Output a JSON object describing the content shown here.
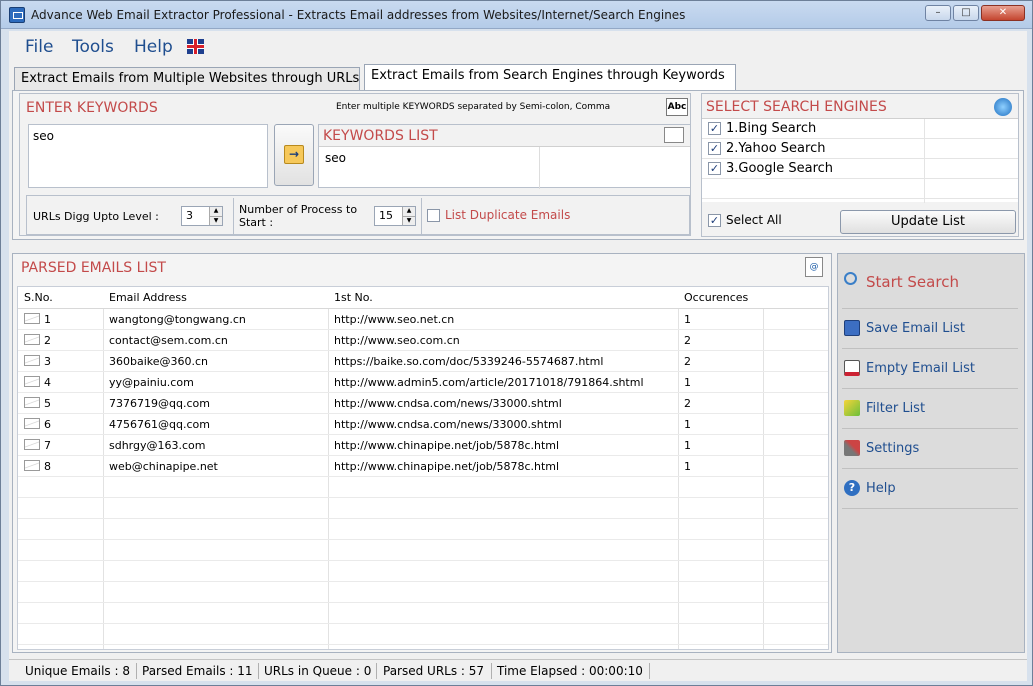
{
  "window": {
    "title": "Advance Web Email Extractor Professional - Extracts Email addresses from Websites/Internet/Search Engines",
    "min": "–",
    "max": "□",
    "close": "✕"
  },
  "menu": {
    "file": "File",
    "tools": "Tools",
    "help": "Help"
  },
  "tabs": [
    {
      "label": "Extract Emails from Multiple Websites through URLs"
    },
    {
      "label": "Extract Emails from Search Engines through Keywords"
    }
  ],
  "keywords": {
    "header": "ENTER KEYWORDS",
    "hint": "Enter multiple KEYWORDS separated by Semi-colon, Comma",
    "input_value": "seo",
    "list_header": "KEYWORDS LIST",
    "list_items": [
      "seo"
    ],
    "abc_icon": "Abc",
    "arrow_icon": "→"
  },
  "options": {
    "digg_label": "URLs Digg Upto Level :",
    "digg_value": "3",
    "process_label_1": "Number of Process to",
    "process_label_2": "Start :",
    "process_value": "15",
    "duplicate_label": "List Duplicate Emails"
  },
  "engines": {
    "header": "SELECT SEARCH ENGINES",
    "items": [
      {
        "label": "1.Bing Search",
        "checked": true
      },
      {
        "label": "2.Yahoo Search",
        "checked": true
      },
      {
        "label": "3.Google Search",
        "checked": true
      }
    ],
    "select_all": "Select All",
    "update_button": "Update List"
  },
  "emails": {
    "header": "PARSED EMAILS LIST",
    "columns": [
      "S.No.",
      "Email Address",
      "1st No.",
      "Occurences"
    ],
    "rows": [
      {
        "no": "1",
        "email": "wangtong@tongwang.cn",
        "url": "http://www.seo.net.cn",
        "occ": "1"
      },
      {
        "no": "2",
        "email": "contact@sem.com.cn",
        "url": "http://www.seo.com.cn",
        "occ": "2"
      },
      {
        "no": "3",
        "email": "360baike@360.cn",
        "url": "https://baike.so.com/doc/5339246-5574687.html",
        "occ": "2"
      },
      {
        "no": "4",
        "email": "yy@painiu.com",
        "url": "http://www.admin5.com/article/20171018/791864.shtml",
        "occ": "1"
      },
      {
        "no": "5",
        "email": "7376719@qq.com",
        "url": "http://www.cndsa.com/news/33000.shtml",
        "occ": "2"
      },
      {
        "no": "6",
        "email": "4756761@qq.com",
        "url": "http://www.cndsa.com/news/33000.shtml",
        "occ": "1"
      },
      {
        "no": "7",
        "email": "sdhrgy@163.com",
        "url": "http://www.chinapipe.net/job/5878c.html",
        "occ": "1"
      },
      {
        "no": "8",
        "email": "web@chinapipe.net",
        "url": "http://www.chinapipe.net/job/5878c.html",
        "occ": "1"
      }
    ]
  },
  "actions": {
    "start_search": "Start Search",
    "save_list": "Save Email List",
    "empty_list": "Empty Email List",
    "filter_list": "Filter List",
    "settings": "Settings",
    "help": "Help"
  },
  "status": {
    "unique": "Unique Emails :  8",
    "parsed": "Parsed Emails :  11",
    "queue": "URLs in Queue :  0",
    "parsed_urls": "Parsed URLs :  57",
    "elapsed": "Time Elapsed :  00:00:10"
  },
  "colors": {
    "accent_red": "#c34a4a",
    "link_blue": "#1f4e8f"
  }
}
